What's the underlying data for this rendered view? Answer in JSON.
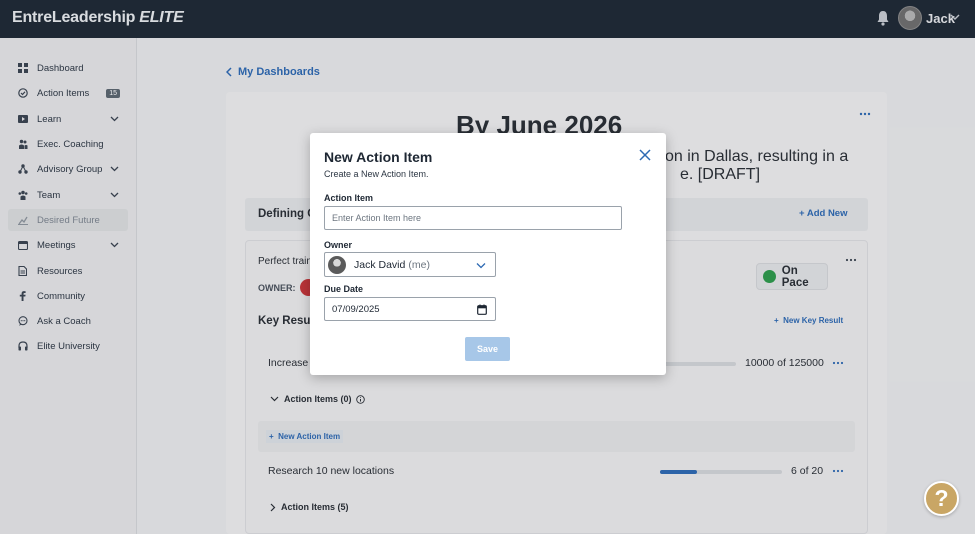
{
  "header": {
    "brand": "EntreLeadership",
    "brand_suffix": "ELITE",
    "user_name": "Jack"
  },
  "sidebar": {
    "items": [
      {
        "label": "Dashboard",
        "icon": "grid-icon"
      },
      {
        "label": "Action Items",
        "icon": "check-circle-icon",
        "badge": "15"
      },
      {
        "label": "Learn",
        "icon": "play-icon"
      },
      {
        "label": "Exec. Coaching",
        "icon": "people-icon"
      },
      {
        "label": "Advisory Group",
        "icon": "network-icon"
      },
      {
        "label": "Team",
        "icon": "team-icon"
      },
      {
        "label": "Desired Future",
        "icon": "chart-icon"
      },
      {
        "label": "Meetings",
        "icon": "calendar-icon"
      },
      {
        "label": "Resources",
        "icon": "document-icon"
      },
      {
        "label": "Community",
        "icon": "facebook-icon"
      },
      {
        "label": "Ask a Coach",
        "icon": "chat-icon"
      },
      {
        "label": "Elite University",
        "icon": "headphones-icon"
      }
    ]
  },
  "main": {
    "back_label": "My Dashboards",
    "goal_title": "By June 2026",
    "goal_desc_line1": "on in Dallas, resulting in a",
    "goal_desc_line2": "e. [DRAFT]",
    "defining": "Defining C",
    "add_new": "Add New",
    "objective": "Perfect train",
    "owner_label": "OWNER:",
    "status": "On Pace",
    "key_results_label": "Key Resul",
    "new_key_result": "New Key Result",
    "kr1_name": "Increase s",
    "kr1_value": "10000 of 125000",
    "kr1_action_items": "Action Items (0)",
    "new_action_item": "New Action Item",
    "kr2_name": "Research 10 new locations",
    "kr2_value": "6 of 20",
    "kr2_progress": 0.3,
    "kr2_action_items": "Action Items (5)"
  },
  "modal": {
    "title": "New Action Item",
    "subtitle": "Create a New Action Item.",
    "action_item_label": "Action Item",
    "action_item_placeholder": "Enter Action Item here",
    "action_item_value": "",
    "owner_label": "Owner",
    "owner_name": "Jack David",
    "owner_suffix": "(me)",
    "due_label": "Due Date",
    "due_value": "07/09/2025",
    "save_label": "Save"
  },
  "help_label": "?",
  "colors": {
    "accent": "#2e6ab3",
    "header": "#1f2a36",
    "on_pace": "#2e9b4d",
    "help": "#c9a665",
    "save_disabled": "#a7c7e8"
  }
}
